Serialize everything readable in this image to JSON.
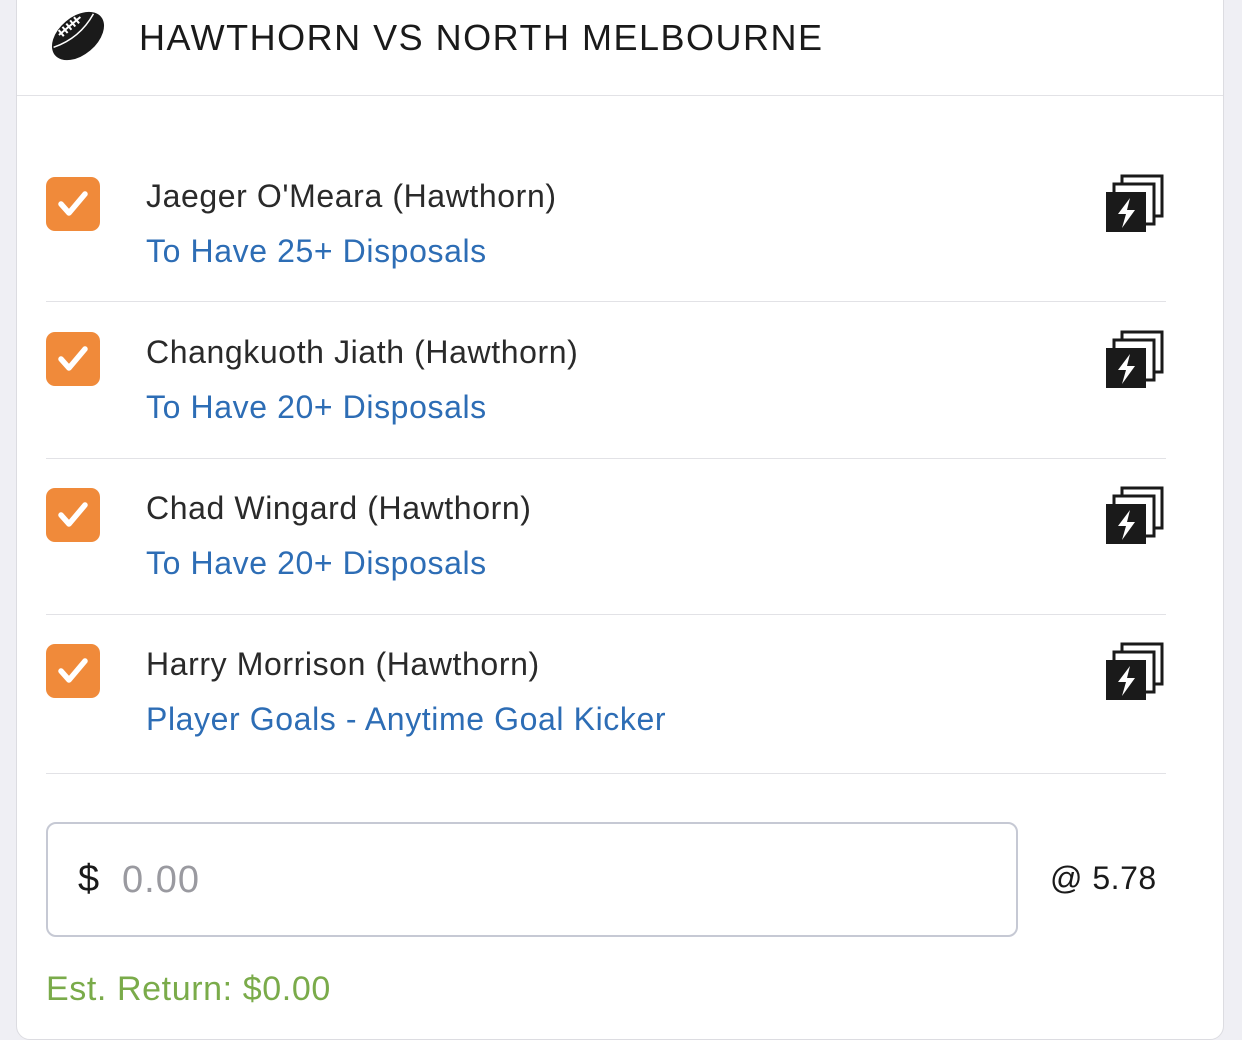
{
  "event": {
    "title": "HAWTHORN VS NORTH MELBOURNE",
    "icon": "football-icon"
  },
  "legs": [
    {
      "checked": true,
      "name": "Jaeger O'Meara (Hawthorn)",
      "market": "To Have 25+ Disposals"
    },
    {
      "checked": true,
      "name": "Changkuoth Jiath (Hawthorn)",
      "market": "To Have 20+ Disposals"
    },
    {
      "checked": true,
      "name": "Chad Wingard (Hawthorn)",
      "market": "To Have 20+ Disposals"
    },
    {
      "checked": true,
      "name": "Harry Morrison (Hawthorn)",
      "market": "Player Goals - Anytime Goal Kicker"
    }
  ],
  "stake": {
    "currency": "$",
    "placeholder": "0.00",
    "value": ""
  },
  "odds": "@ 5.78",
  "est_return": "Est. Return: $0.00",
  "colors": {
    "checkbox": "#f08a3a",
    "market_link": "#2d6db5",
    "est_return": "#7aab4a"
  }
}
